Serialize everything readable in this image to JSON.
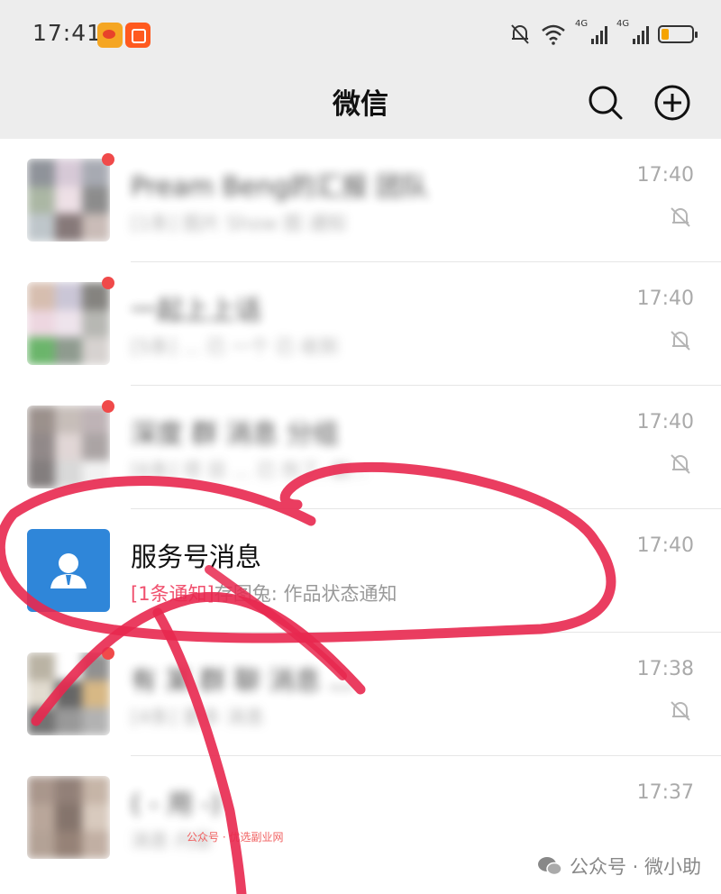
{
  "status_bar": {
    "time": "17:41",
    "network_label_1": "4G",
    "network_label_2": "4G",
    "battery_level": 0.25
  },
  "nav": {
    "title": "微信",
    "search_icon": "search-icon",
    "add_icon": "plus-circle-icon"
  },
  "chats": [
    {
      "name": "Pream  Beng的汇报 团队",
      "preview": "[1条] 图片 Show 图 通知",
      "time": "17:40",
      "muted": true,
      "unread_dot": true
    },
    {
      "name": "一起上上话",
      "preview": "[5条] ...  已 一个 已 收到",
      "time": "17:40",
      "muted": true,
      "unread_dot": true
    },
    {
      "name": "深度 群 消息 分组",
      "preview": "[6条] 项 目 ... 已 伤了, 啟...",
      "time": "17:40",
      "muted": true,
      "unread_dot": true
    },
    {
      "name": "服务号消息",
      "preview_tag": "[1条通知]",
      "preview": "存图兔: 作品状态通知",
      "time": "17:40",
      "muted": false,
      "unread_dot": false
    },
    {
      "name": "有 某 群 聊 消息 ...",
      "preview": "[4条] 更多 消息",
      "time": "17:38",
      "muted": true,
      "unread_dot": true
    },
    {
      "name": "( - 用 -)",
      "preview": "消息 内容",
      "time": "17:37",
      "muted": false,
      "unread_dot": false
    }
  ],
  "watermark": "公众号 · 优选副业网",
  "wechat_mark": "公众号 · 微小助",
  "colors": {
    "bar_bg": "#ededed",
    "service_avatar": "#2f86d9",
    "unread": "#f04a4a",
    "scribble": "#e8284f"
  }
}
